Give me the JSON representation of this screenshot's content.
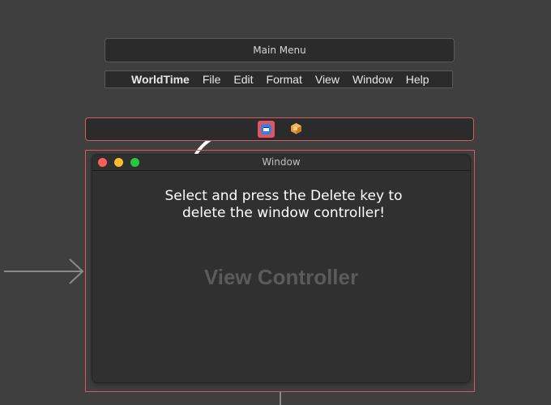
{
  "main_menu": {
    "title": "Main Menu"
  },
  "menu_bar": {
    "app_name": "WorldTime",
    "items": [
      "File",
      "Edit",
      "Format",
      "View",
      "Window",
      "Help"
    ]
  },
  "window": {
    "title": "Window",
    "content_label": "View Controller"
  },
  "annotation": {
    "line1": "Select and press the Delete key to",
    "line2": "delete the window controller!"
  },
  "colors": {
    "selection_border": "#d35a62",
    "canvas_background": "#3f3f3f"
  }
}
